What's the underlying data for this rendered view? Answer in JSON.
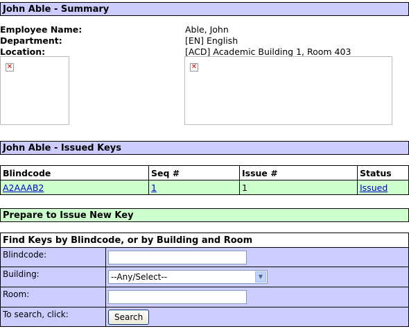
{
  "summary": {
    "title": "John Able - Summary",
    "employee_name_label": "Employee Name:",
    "employee_name_value": "Able, John",
    "department_label": "Department:",
    "department_value": "[EN] English",
    "location_label": "Location:",
    "location_value": "[ACD] Academic Building 1, Room 403"
  },
  "issued_keys": {
    "title": "John Able - Issued Keys",
    "columns": [
      "Blindcode",
      "Seq #",
      "Issue #",
      "Status"
    ],
    "rows": [
      {
        "blindcode": "A2AAAB2",
        "seq": "1",
        "issue": "1",
        "status": "Issued"
      }
    ]
  },
  "prepare": {
    "title": "Prepare to Issue New Key"
  },
  "find": {
    "title": "Find Keys by Blindcode, or by Building and Room",
    "blindcode_label": "Blindcode:",
    "blindcode_value": "",
    "building_label": "Building:",
    "building_selected": "--Any/Select--",
    "room_label": "Room:",
    "room_value": "",
    "search_label": "To search, click:",
    "search_button": "Search"
  },
  "colors": {
    "header_lavender": "#ccccff",
    "header_green": "#ccffcc",
    "link": "#0000cc"
  }
}
